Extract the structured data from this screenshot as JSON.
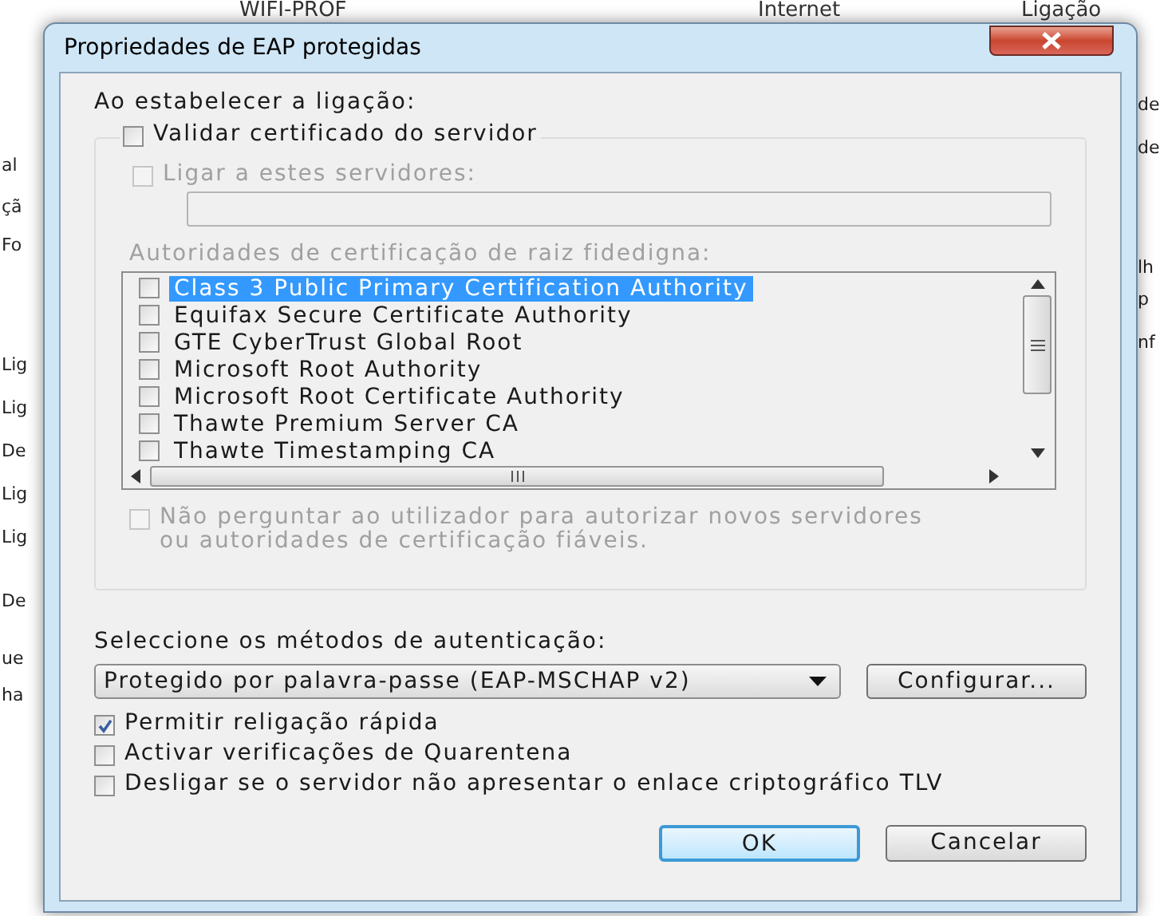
{
  "background_window": {
    "header": [
      "WIFI-PROF",
      "Internet",
      "Ligação"
    ],
    "left_fragments": [
      "al",
      "çã",
      "Fo",
      "Lig",
      "Lig",
      "De",
      "Lig",
      "Lig",
      "De",
      "ue",
      "ha"
    ],
    "right_fragments": [
      "de",
      "de",
      "lh",
      "p",
      "nf"
    ]
  },
  "dialog": {
    "title": "Propriedades de EAP protegidas",
    "connect_label": "Ao estabelecer a ligação:",
    "validate_certificate": {
      "label": "Validar certificado do servidor",
      "checked": false
    },
    "connect_servers": {
      "label": "Ligar a estes servidores:",
      "checked": false,
      "disabled": true
    },
    "authorities_label": "Autoridades de certificação de raiz fidedigna:",
    "authorities": [
      {
        "name": "Class 3 Public Primary Certification Authority",
        "checked": false,
        "selected": true
      },
      {
        "name": "Equifax Secure Certificate Authority",
        "checked": false,
        "selected": false
      },
      {
        "name": "GTE CyberTrust Global Root",
        "checked": false,
        "selected": false
      },
      {
        "name": "Microsoft Root Authority",
        "checked": false,
        "selected": false
      },
      {
        "name": "Microsoft Root Certificate Authority",
        "checked": false,
        "selected": false
      },
      {
        "name": "Thawte Premium Server CA",
        "checked": false,
        "selected": false
      },
      {
        "name": "Thawte Timestamping CA",
        "checked": false,
        "selected": false
      }
    ],
    "no_prompt": {
      "label": "Não perguntar ao utilizador para autorizar novos servidores ou autoridades de certificação fiáveis.",
      "checked": false,
      "disabled": true
    },
    "methods_label": "Seleccione os métodos de autenticação:",
    "method": {
      "value": "Protegido por palavra-passe (EAP-MSCHAP v2)"
    },
    "configure_button": "Configurar...",
    "options": [
      {
        "label": "Permitir religação rápida",
        "checked": true
      },
      {
        "label": "Activar verificações de Quarentena",
        "checked": false
      },
      {
        "label": "Desligar se o servidor não apresentar o enlace criptográfico TLV",
        "checked": false
      }
    ],
    "buttons": [
      {
        "label": "OK",
        "default": true
      },
      {
        "label": "Cancelar",
        "default": false
      }
    ]
  }
}
